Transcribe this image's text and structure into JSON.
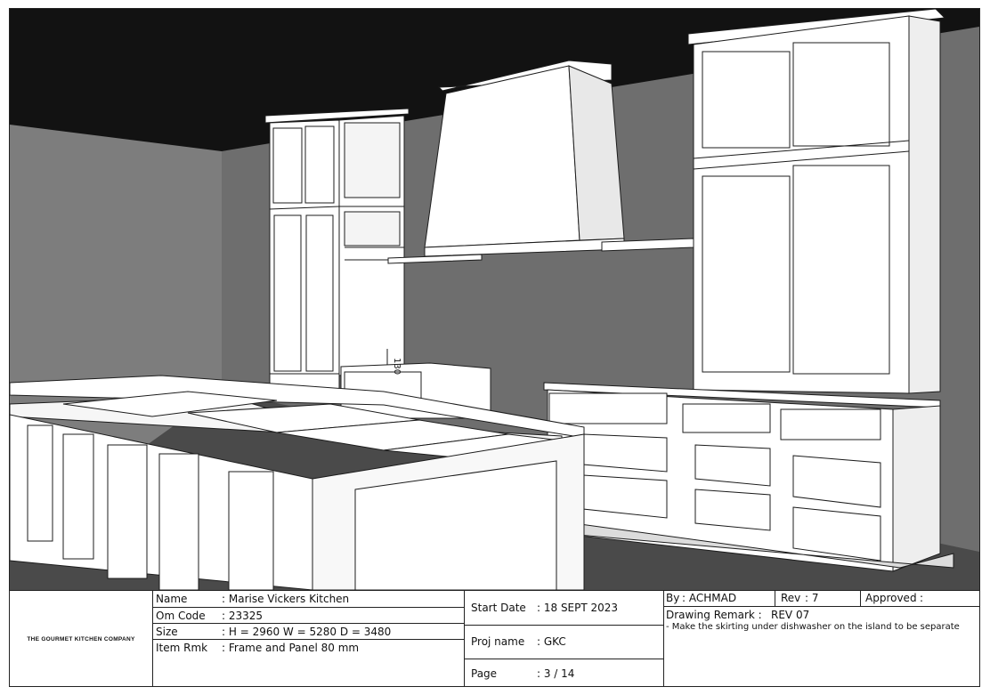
{
  "company": {
    "name": "THE GOURMET KITCHEN COMPANY"
  },
  "drawing": {
    "dimension_label": "130",
    "colors": {
      "ceiling": "#121212",
      "wall": "#6e6e6e",
      "wall_left": "#7d7d7d",
      "floor": "#4a4a4a",
      "cabinet": "#ffffff",
      "line": "#1c1c1c"
    }
  },
  "project": {
    "name_label": "Name",
    "name_value": ": Marise Vickers Kitchen",
    "om_label": "Om Code",
    "om_value": ": 23325",
    "size_label": "Size",
    "size_value": ": H = 2960   W = 5280  D = 3480",
    "rmk_label": "Item Rmk",
    "rmk_value": ": Frame and Panel 80 mm"
  },
  "schedule": {
    "start_label": "Start Date",
    "start_value": ": 18 SEPT 2023",
    "proj_label": "Proj name",
    "proj_value": ": GKC",
    "page_label": "Page",
    "page_value": ": 3 / 14"
  },
  "approval": {
    "by_label": "By",
    "by_value": ": ACHMAD",
    "rev_label": "Rev",
    "rev_value": ": 7",
    "approved_label": "Approved",
    "approved_value": ":",
    "remark_label": "Drawing Remark :",
    "remark_rev": "REV 07",
    "remark_text": "- Make the skirting under dishwasher on the island to be separate"
  }
}
